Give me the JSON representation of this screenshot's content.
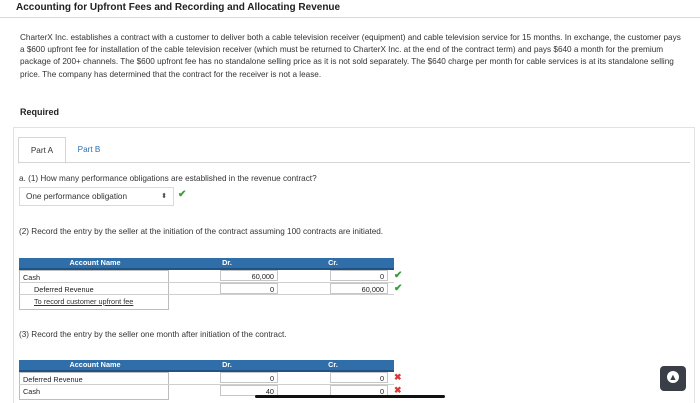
{
  "header": {
    "title": "Accounting for Upfront Fees and Recording and Allocating Revenue"
  },
  "problem": {
    "text": "CharterX Inc. establishes a contract with a customer to deliver both a cable television receiver (equipment) and cable television service for 15 months. In exchange, the customer pays a $600 upfront fee for installation of the cable television receiver (which must be returned to CharterX Inc. at the end of the contract term) and pays $640 a month for the premium package of 200+ channels. The $600 upfront fee has no standalone selling price as it is not sold separately. The $640 charge per month for cable services is at its standalone selling price. The company has determined that the contract for the receiver is not a lease.",
    "required_label": "Required"
  },
  "tabs": [
    {
      "label": "Part A",
      "active": true
    },
    {
      "label": "Part B",
      "active": false
    }
  ],
  "q1": {
    "prompt": "a. (1) How many performance obligations are established in the revenue contract?",
    "selected": "One performance obligation",
    "arrow": "⬍",
    "status": "correct"
  },
  "q2": {
    "prompt": "(2) Record the entry by the seller at the initiation of the contract assuming 100 contracts are initiated.",
    "headers": {
      "account": "Account Name",
      "dr": "Dr.",
      "cr": "Cr."
    },
    "rows": [
      {
        "account": "Cash",
        "dr": "60,000",
        "cr": "0",
        "cr_status": "correct"
      },
      {
        "account": "Deferred Revenue",
        "dr": "0",
        "cr": "60,000",
        "cr_status": "correct"
      }
    ],
    "memo": "To record customer upfront fee"
  },
  "q3": {
    "prompt": "(3) Record the entry by the seller one month after initiation of the contract.",
    "headers": {
      "account": "Account Name",
      "dr": "Dr.",
      "cr": "Cr."
    },
    "rows": [
      {
        "account": "Deferred Revenue",
        "dr": "0",
        "cr": "0",
        "cr_status": "incorrect"
      },
      {
        "account": "Cash",
        "dr": "40",
        "cr": "0",
        "cr_status": "incorrect"
      }
    ]
  },
  "icons": {
    "check": "✔",
    "cross": "✖",
    "scroll_top": "▲"
  },
  "colors": {
    "table_header": "#2f6ea8",
    "correct": "#3c9d3c",
    "incorrect": "#d83a3a",
    "link": "#2e6db4"
  }
}
